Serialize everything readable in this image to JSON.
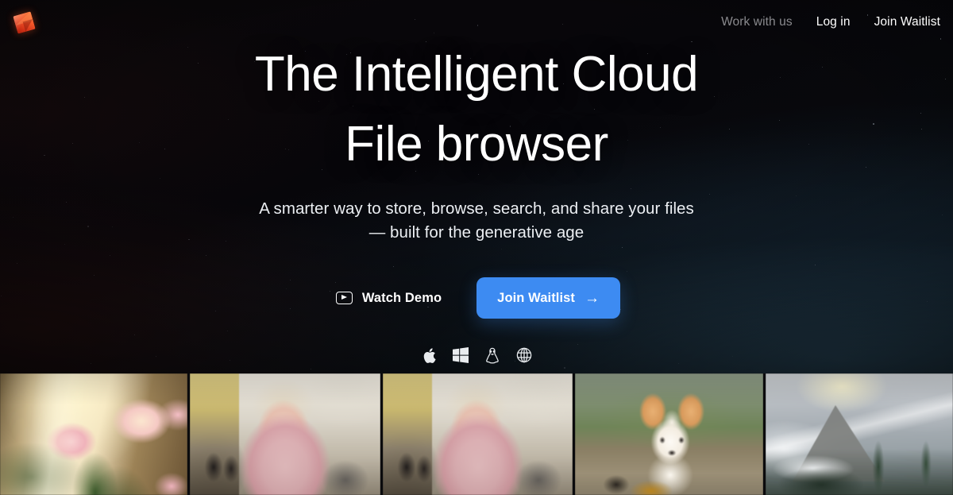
{
  "brand": {
    "logo_icon": "diamond-logo-icon",
    "logo_color": "#f4572a"
  },
  "nav": {
    "links": [
      {
        "label": "Work with us",
        "style": "dim"
      },
      {
        "label": "Log in",
        "style": "normal"
      },
      {
        "label": "Join Waitlist",
        "style": "normal"
      }
    ]
  },
  "hero": {
    "headline_line1": "The Intelligent Cloud",
    "headline_line2": "File browser",
    "subtitle_line1": "A smarter way to store, browse, search, and share your files",
    "subtitle_line2": "— built for the generative age",
    "cta": {
      "watch_demo_label": "Watch Demo",
      "watch_demo_icon": "play-in-rounded-rect-icon",
      "join_waitlist_label": "Join Waitlist",
      "join_waitlist_arrow": "→",
      "join_waitlist_color": "#3d8bf2"
    },
    "platforms": [
      {
        "name": "apple-icon",
        "label": "macOS"
      },
      {
        "name": "windows-icon",
        "label": "Windows"
      },
      {
        "name": "linux-icon",
        "label": "Linux"
      },
      {
        "name": "globe-icon",
        "label": "Web"
      }
    ],
    "background_color": "#060407"
  },
  "gallery": {
    "tiles": [
      {
        "alt": "Pink and cream roses backlit on a sunlit windowsill"
      },
      {
        "alt": "Portrait of a woman with long pink hair on a European city street"
      },
      {
        "alt": "Portrait of a woman with long pink hair on a European city street"
      },
      {
        "alt": "Corgi puppy sitting in a small yellow toy vehicle on a path"
      },
      {
        "alt": "Snow-covered mountain peak with pine trees and drifting clouds"
      }
    ]
  }
}
